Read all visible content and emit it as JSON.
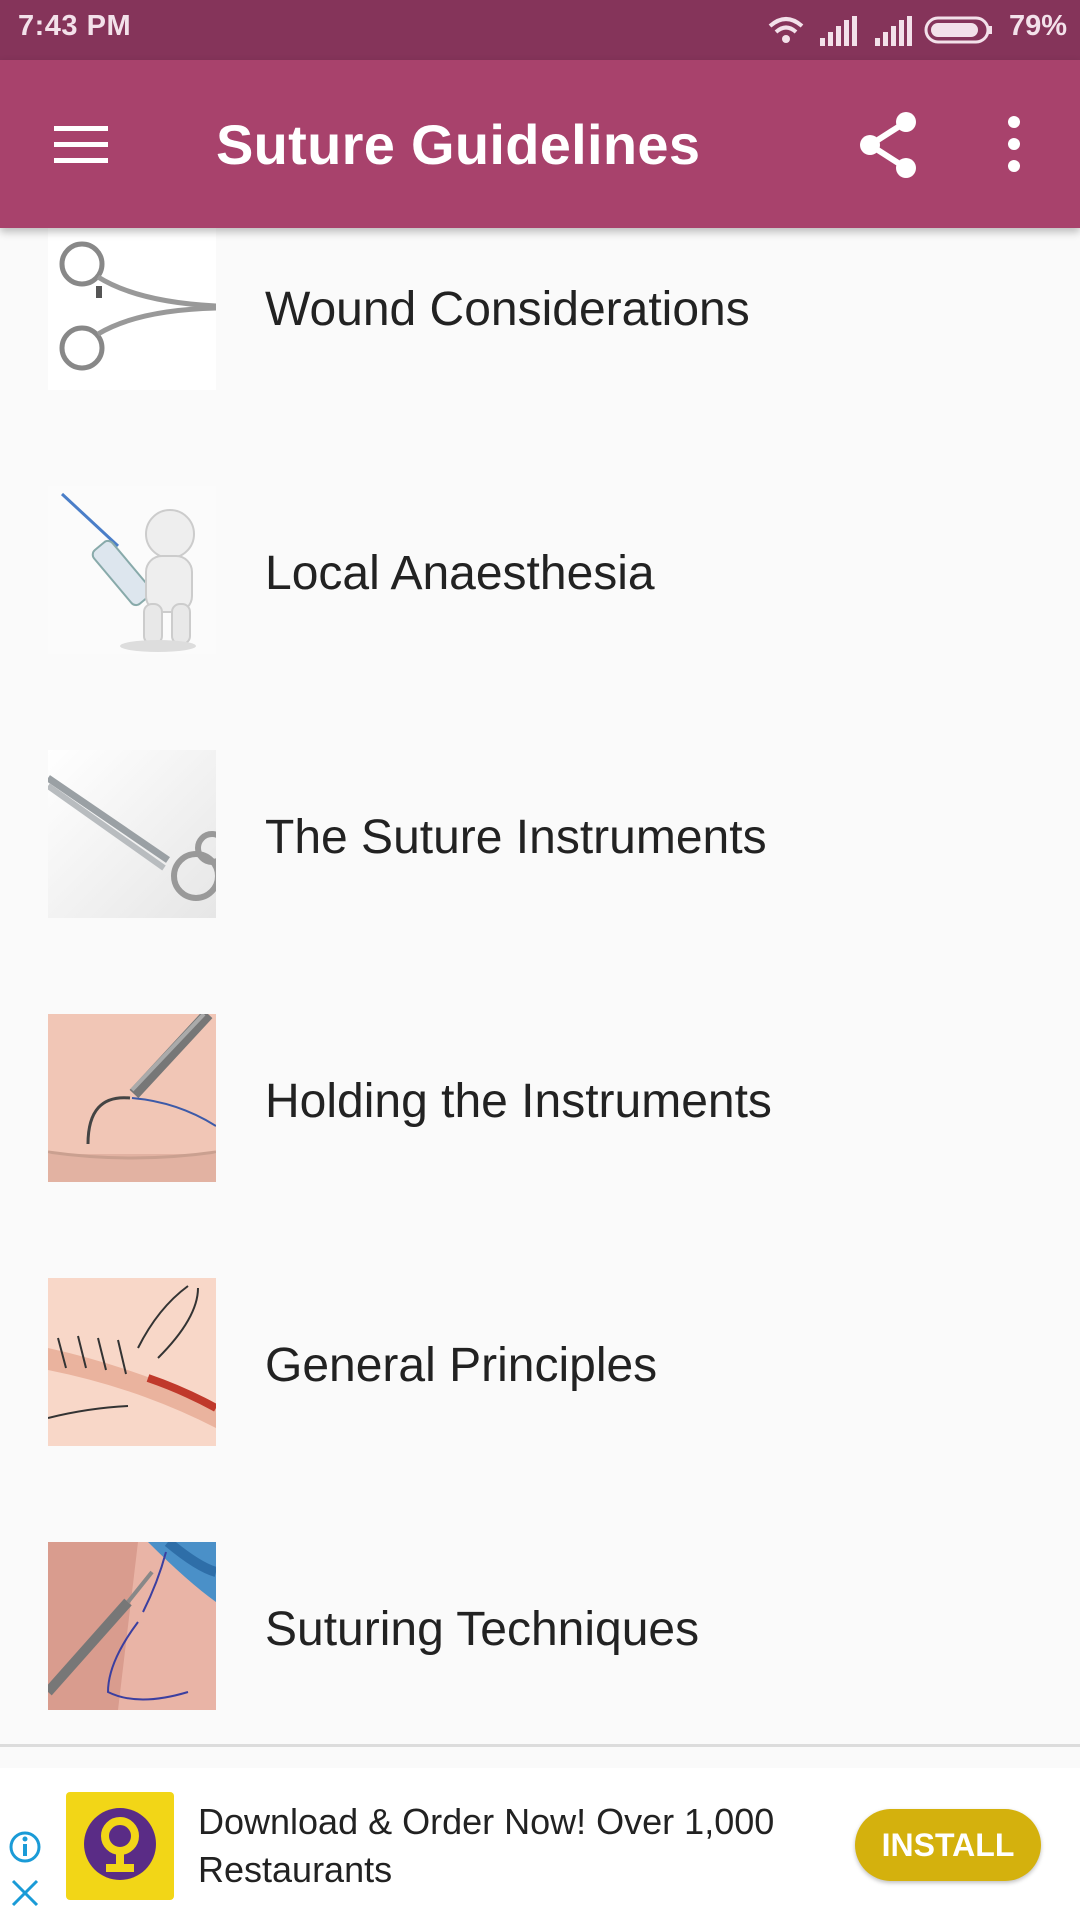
{
  "status_bar": {
    "time": "7:43 PM",
    "battery_percent": "79%",
    "icons": [
      "wifi-icon",
      "signal-icon",
      "signal-icon",
      "battery-icon"
    ]
  },
  "app_bar": {
    "title": "Suture Guidelines",
    "icons": [
      "menu-icon",
      "share-icon",
      "more-vert-icon"
    ],
    "color": "#a8426c"
  },
  "topics": [
    {
      "label": "Wound Considerations",
      "thumb": "forceps-image"
    },
    {
      "label": "Local Anaesthesia",
      "thumb": "syringe-figure-image"
    },
    {
      "label": "The Suture Instruments",
      "thumb": "needle-holder-image"
    },
    {
      "label": "Holding the Instruments",
      "thumb": "needle-on-skin-image"
    },
    {
      "label": "General Principles",
      "thumb": "sutured-wound-image"
    },
    {
      "label": "Suturing Techniques",
      "thumb": "suturing-practice-image"
    }
  ],
  "ad": {
    "text": "Download & Order Now! Over 1,000 Restaurants",
    "button": "INSTALL",
    "button_color": "#d4b10d",
    "icons": [
      "ad-info-icon",
      "ad-close-icon",
      "app-logo-icon"
    ]
  }
}
